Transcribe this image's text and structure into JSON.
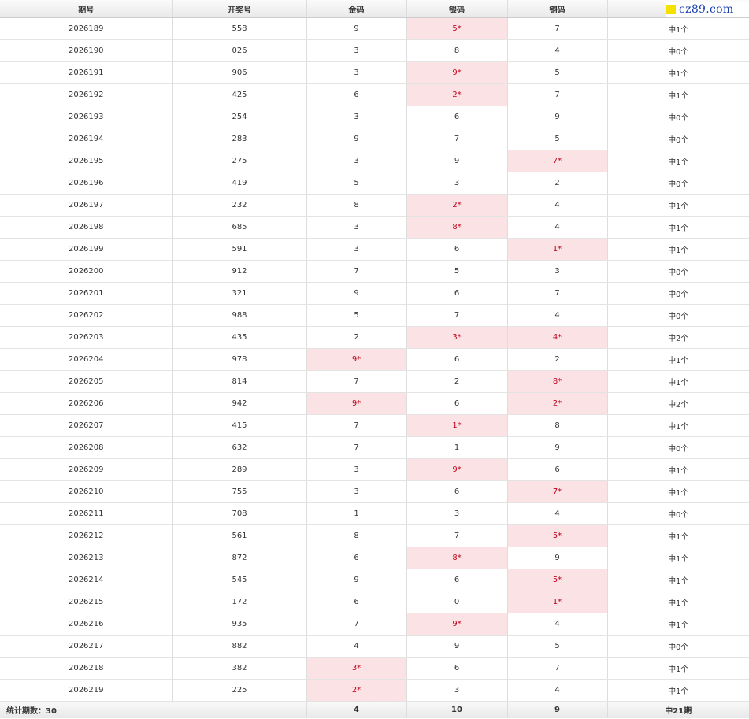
{
  "headers": [
    "期号",
    "开奖号",
    "金码",
    "银码",
    "铜码",
    ""
  ],
  "logo": {
    "text": "cz89.com",
    "accent": "#f6e000",
    "color": "#1a40b0"
  },
  "colors": {
    "hit_bg": "#fbe3e5",
    "hit_text": "#c0001a"
  },
  "rows": [
    {
      "issue": "2026189",
      "number": "558",
      "gold": "9",
      "silver": "5*",
      "bronze": "7",
      "result": "中1个",
      "hits": [
        "silver"
      ]
    },
    {
      "issue": "2026190",
      "number": "026",
      "gold": "3",
      "silver": "8",
      "bronze": "4",
      "result": "中0个",
      "hits": []
    },
    {
      "issue": "2026191",
      "number": "906",
      "gold": "3",
      "silver": "9*",
      "bronze": "5",
      "result": "中1个",
      "hits": [
        "silver"
      ]
    },
    {
      "issue": "2026192",
      "number": "425",
      "gold": "6",
      "silver": "2*",
      "bronze": "7",
      "result": "中1个",
      "hits": [
        "silver"
      ]
    },
    {
      "issue": "2026193",
      "number": "254",
      "gold": "3",
      "silver": "6",
      "bronze": "9",
      "result": "中0个",
      "hits": []
    },
    {
      "issue": "2026194",
      "number": "283",
      "gold": "9",
      "silver": "7",
      "bronze": "5",
      "result": "中0个",
      "hits": []
    },
    {
      "issue": "2026195",
      "number": "275",
      "gold": "3",
      "silver": "9",
      "bronze": "7*",
      "result": "中1个",
      "hits": [
        "bronze"
      ]
    },
    {
      "issue": "2026196",
      "number": "419",
      "gold": "5",
      "silver": "3",
      "bronze": "2",
      "result": "中0个",
      "hits": []
    },
    {
      "issue": "2026197",
      "number": "232",
      "gold": "8",
      "silver": "2*",
      "bronze": "4",
      "result": "中1个",
      "hits": [
        "silver"
      ]
    },
    {
      "issue": "2026198",
      "number": "685",
      "gold": "3",
      "silver": "8*",
      "bronze": "4",
      "result": "中1个",
      "hits": [
        "silver"
      ]
    },
    {
      "issue": "2026199",
      "number": "591",
      "gold": "3",
      "silver": "6",
      "bronze": "1*",
      "result": "中1个",
      "hits": [
        "bronze"
      ]
    },
    {
      "issue": "2026200",
      "number": "912",
      "gold": "7",
      "silver": "5",
      "bronze": "3",
      "result": "中0个",
      "hits": []
    },
    {
      "issue": "2026201",
      "number": "321",
      "gold": "9",
      "silver": "6",
      "bronze": "7",
      "result": "中0个",
      "hits": []
    },
    {
      "issue": "2026202",
      "number": "988",
      "gold": "5",
      "silver": "7",
      "bronze": "4",
      "result": "中0个",
      "hits": []
    },
    {
      "issue": "2026203",
      "number": "435",
      "gold": "2",
      "silver": "3*",
      "bronze": "4*",
      "result": "中2个",
      "hits": [
        "silver",
        "bronze"
      ]
    },
    {
      "issue": "2026204",
      "number": "978",
      "gold": "9*",
      "silver": "6",
      "bronze": "2",
      "result": "中1个",
      "hits": [
        "gold"
      ]
    },
    {
      "issue": "2026205",
      "number": "814",
      "gold": "7",
      "silver": "2",
      "bronze": "8*",
      "result": "中1个",
      "hits": [
        "bronze"
      ]
    },
    {
      "issue": "2026206",
      "number": "942",
      "gold": "9*",
      "silver": "6",
      "bronze": "2*",
      "result": "中2个",
      "hits": [
        "gold",
        "bronze"
      ]
    },
    {
      "issue": "2026207",
      "number": "415",
      "gold": "7",
      "silver": "1*",
      "bronze": "8",
      "result": "中1个",
      "hits": [
        "silver"
      ]
    },
    {
      "issue": "2026208",
      "number": "632",
      "gold": "7",
      "silver": "1",
      "bronze": "9",
      "result": "中0个",
      "hits": []
    },
    {
      "issue": "2026209",
      "number": "289",
      "gold": "3",
      "silver": "9*",
      "bronze": "6",
      "result": "中1个",
      "hits": [
        "silver"
      ]
    },
    {
      "issue": "2026210",
      "number": "755",
      "gold": "3",
      "silver": "6",
      "bronze": "7*",
      "result": "中1个",
      "hits": [
        "bronze"
      ]
    },
    {
      "issue": "2026211",
      "number": "708",
      "gold": "1",
      "silver": "3",
      "bronze": "4",
      "result": "中0个",
      "hits": []
    },
    {
      "issue": "2026212",
      "number": "561",
      "gold": "8",
      "silver": "7",
      "bronze": "5*",
      "result": "中1个",
      "hits": [
        "bronze"
      ]
    },
    {
      "issue": "2026213",
      "number": "872",
      "gold": "6",
      "silver": "8*",
      "bronze": "9",
      "result": "中1个",
      "hits": [
        "silver"
      ]
    },
    {
      "issue": "2026214",
      "number": "545",
      "gold": "9",
      "silver": "6",
      "bronze": "5*",
      "result": "中1个",
      "hits": [
        "bronze"
      ]
    },
    {
      "issue": "2026215",
      "number": "172",
      "gold": "6",
      "silver": "0",
      "bronze": "1*",
      "result": "中1个",
      "hits": [
        "bronze"
      ]
    },
    {
      "issue": "2026216",
      "number": "935",
      "gold": "7",
      "silver": "9*",
      "bronze": "4",
      "result": "中1个",
      "hits": [
        "silver"
      ]
    },
    {
      "issue": "2026217",
      "number": "882",
      "gold": "4",
      "silver": "9",
      "bronze": "5",
      "result": "中0个",
      "hits": []
    },
    {
      "issue": "2026218",
      "number": "382",
      "gold": "3*",
      "silver": "6",
      "bronze": "7",
      "result": "中1个",
      "hits": [
        "gold"
      ]
    },
    {
      "issue": "2026219",
      "number": "225",
      "gold": "2*",
      "silver": "3",
      "bronze": "4",
      "result": "中1个",
      "hits": [
        "gold"
      ]
    }
  ],
  "footer": {
    "label": "统计期数：30",
    "gold_total": "4",
    "silver_total": "10",
    "bronze_total": "9",
    "result_total": "中21期"
  }
}
